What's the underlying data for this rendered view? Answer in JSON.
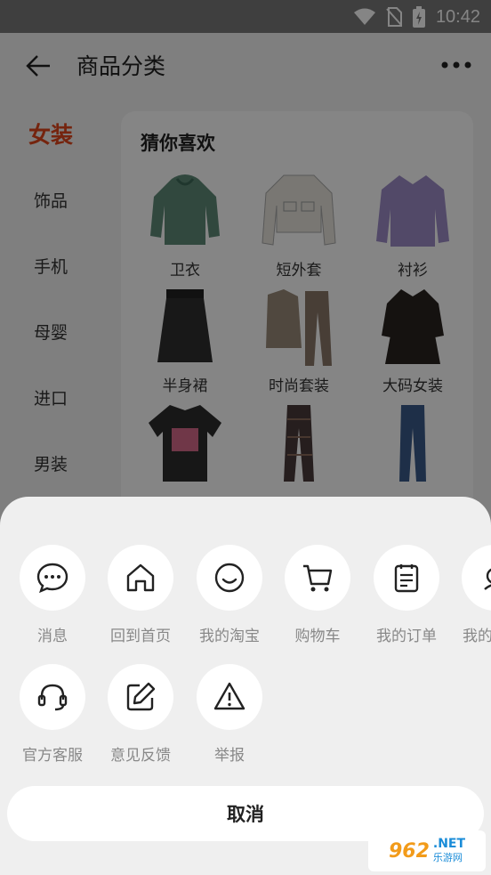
{
  "status_bar": {
    "time": "10:42"
  },
  "header": {
    "title": "商品分类"
  },
  "left_nav": [
    {
      "label": "女装",
      "active": true
    },
    {
      "label": "饰品"
    },
    {
      "label": "手机"
    },
    {
      "label": "母婴"
    },
    {
      "label": "进口"
    },
    {
      "label": "男装"
    }
  ],
  "card": {
    "title": "猜你喜欢",
    "products": [
      {
        "label": "卫衣",
        "icon": "hoodie"
      },
      {
        "label": "短外套",
        "icon": "short-jacket"
      },
      {
        "label": "衬衫",
        "icon": "shirt"
      },
      {
        "label": "半身裙",
        "icon": "skirt"
      },
      {
        "label": "时尚套装",
        "icon": "suit"
      },
      {
        "label": "大码女装",
        "icon": "dress"
      },
      {
        "label": "",
        "icon": "tshirt"
      },
      {
        "label": "",
        "icon": "plaid-pants"
      },
      {
        "label": "",
        "icon": "jeans"
      }
    ]
  },
  "sheet": {
    "row1": [
      {
        "label": "消息",
        "icon": "message-icon"
      },
      {
        "label": "回到首页",
        "icon": "home-icon"
      },
      {
        "label": "我的淘宝",
        "icon": "smile-icon"
      },
      {
        "label": "购物车",
        "icon": "cart-icon"
      },
      {
        "label": "我的订单",
        "icon": "order-icon"
      },
      {
        "label": "我的",
        "icon": "partial-icon"
      }
    ],
    "row2": [
      {
        "label": "官方客服",
        "icon": "headset-icon"
      },
      {
        "label": "意见反馈",
        "icon": "edit-icon"
      },
      {
        "label": "举报",
        "icon": "warning-icon"
      }
    ],
    "cancel_label": "取消"
  },
  "watermark": {
    "number": "962",
    "net": ".NET",
    "sub": "乐游网"
  },
  "colors": {
    "accent": "#e0461b",
    "overlay": "rgba(0,0,0,0.48)",
    "sheet_bg": "#efefef"
  }
}
